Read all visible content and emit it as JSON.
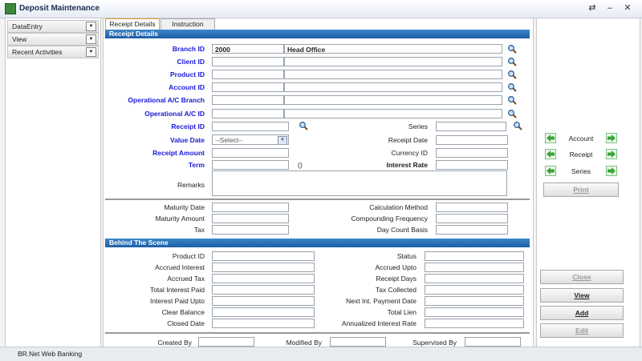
{
  "window": {
    "title": "Deposit Maintenance"
  },
  "left_nav": [
    {
      "label": "DataEntry"
    },
    {
      "label": "View"
    },
    {
      "label": "Recent Activities"
    }
  ],
  "tabs": [
    {
      "label": "Receipt Details",
      "active": true
    },
    {
      "label": "Instruction",
      "active": false
    }
  ],
  "receipt": {
    "header": "Receipt Details",
    "branch_id_label": "Branch ID",
    "branch_id_value": "2000",
    "branch_name_value": "Head Office",
    "client_id_label": "Client ID",
    "product_id_label": "Product ID",
    "account_id_label": "Account ID",
    "op_branch_label": "Operational A/C Branch",
    "op_ac_label": "Operational A/C ID",
    "receipt_id_label": "Receipt ID",
    "series_label": "Series",
    "value_date_label": "Value Date",
    "value_date_select": "--Select--",
    "receipt_date_label": "Receipt Date",
    "receipt_amount_label": "Receipt Amount",
    "currency_id_label": "Currency ID",
    "term_label": "Term",
    "term_unit": "()",
    "interest_rate_label": "Interest Rate",
    "remarks_label": "Remarks"
  },
  "maturity": {
    "maturity_date_label": "Maturity Date",
    "calc_method_label": "Calculation Method",
    "maturity_amount_label": "Maturity Amount",
    "compounding_label": "Compounding Frequency",
    "tax_label": "Tax",
    "day_count_label": "Day Count Basis"
  },
  "behind": {
    "header": "Behind The Scene",
    "product_id_label": "Product ID",
    "status_label": "Status",
    "accrued_interest_label": "Accrued Interest",
    "accrued_upto_label": "Accrued Upto",
    "accrued_tax_label": "Accrued Tax",
    "receipt_days_label": "Receipt Days",
    "total_interest_paid_label": "Total Interest Paid",
    "tax_collected_label": "Tax Collected",
    "interest_paid_upto_label": "Interest Paid Upto",
    "next_int_payment_label": "Next Int. Payment Date",
    "clear_balance_label": "Clear Balance",
    "total_lien_label": "Total Lien",
    "closed_date_label": "Closed Date",
    "annualized_rate_label": "Annualized Interest Rate"
  },
  "audit": {
    "created_by_label": "Created By",
    "modified_by_label": "Modified By",
    "supervised_by_label": "Supervised By"
  },
  "right_nav": {
    "account_label": "Account",
    "receipt_label": "Receipt",
    "series_label": "Series",
    "print_label": "Print",
    "close_label": "Close",
    "view_label": "View",
    "add_label": "Add",
    "edit_label": "Edit"
  },
  "status_bar": {
    "text": "BR.Net Web Banking"
  },
  "colors": {
    "accent": "#1d5fa5",
    "label_blue": "#1a1ad6",
    "arrow_green": "#3aa33a"
  }
}
